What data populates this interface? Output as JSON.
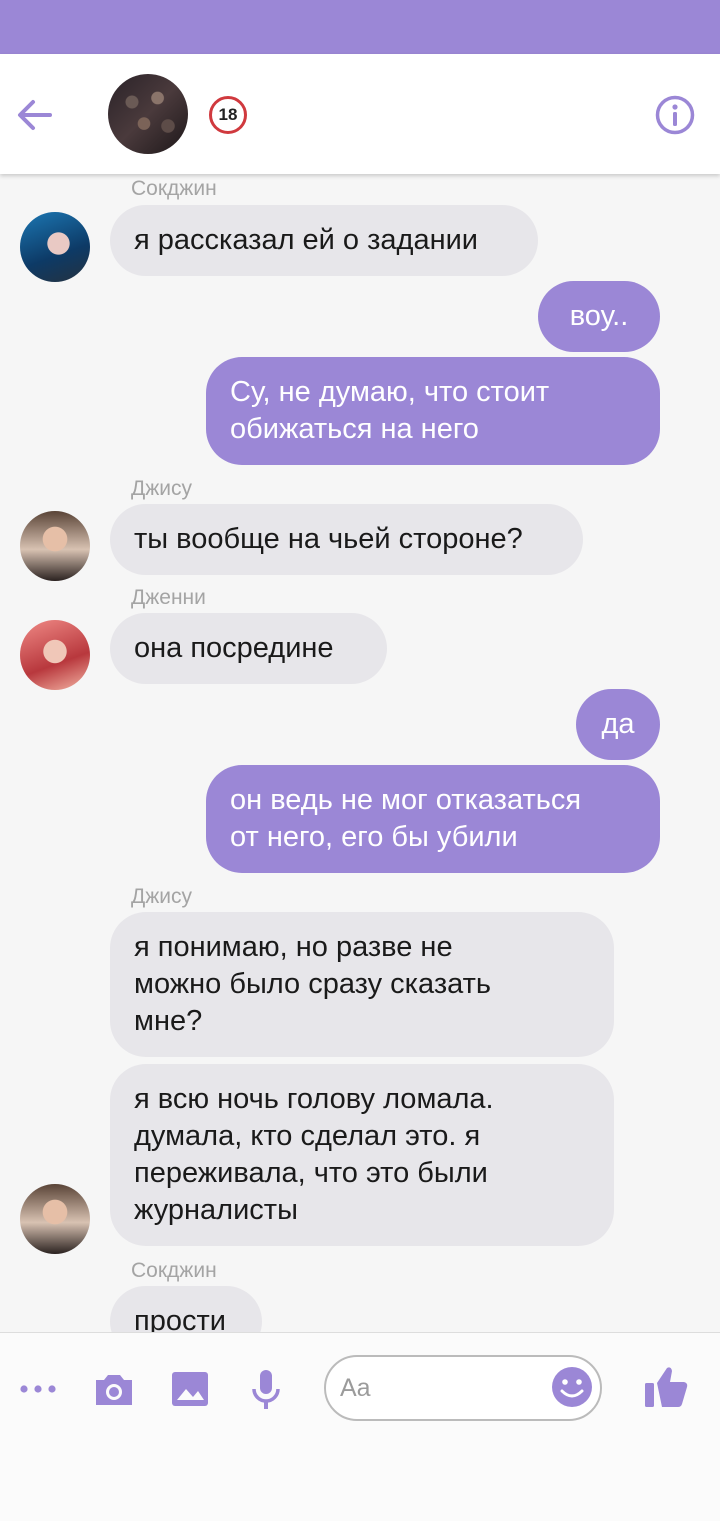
{
  "header": {
    "badge": "18",
    "colors": {
      "accent": "#9b87d6",
      "background": "#ffffff"
    },
    "icons": {
      "back": "arrow-left-icon",
      "info": "info-icon"
    }
  },
  "messages": [
    {
      "id": "m1",
      "type": "incoming",
      "sender": "Сокджин",
      "text": "я рассказал ей о задании"
    },
    {
      "id": "m2",
      "type": "outgoing",
      "text": "воу.."
    },
    {
      "id": "m3",
      "type": "outgoing",
      "text": "Су, не думаю, что стоит\nобижаться на него"
    },
    {
      "id": "m4",
      "type": "incoming",
      "sender": "Джису",
      "text": "ты вообще на чьей стороне?"
    },
    {
      "id": "m5",
      "type": "incoming",
      "sender": "Дженни",
      "text": "она посредине"
    },
    {
      "id": "m6",
      "type": "outgoing",
      "text": "да"
    },
    {
      "id": "m7",
      "type": "outgoing",
      "text": "он ведь не мог отказаться\nот него, его бы убили"
    },
    {
      "id": "m8",
      "type": "incoming",
      "sender": "Джису",
      "text": "я понимаю, но разве не\nможно было сразу сказать\nмне?"
    },
    {
      "id": "m9",
      "type": "incoming",
      "text": "я всю ночь голову ломала.\nдумала, кто сделал это. я\nпереживала, что это были\nжурналисты"
    },
    {
      "id": "m10",
      "type": "incoming",
      "sender": "Сокджин",
      "text": "прости"
    }
  ],
  "composer": {
    "placeholder": "Aa",
    "icons": [
      "more-icon",
      "camera-icon",
      "image-icon",
      "microphone-icon",
      "emoji-icon",
      "like-icon"
    ],
    "colors": {
      "icon": "#9b87d6",
      "bubble_in": "#e7e6ea",
      "bubble_out": "#9b87d6"
    }
  }
}
